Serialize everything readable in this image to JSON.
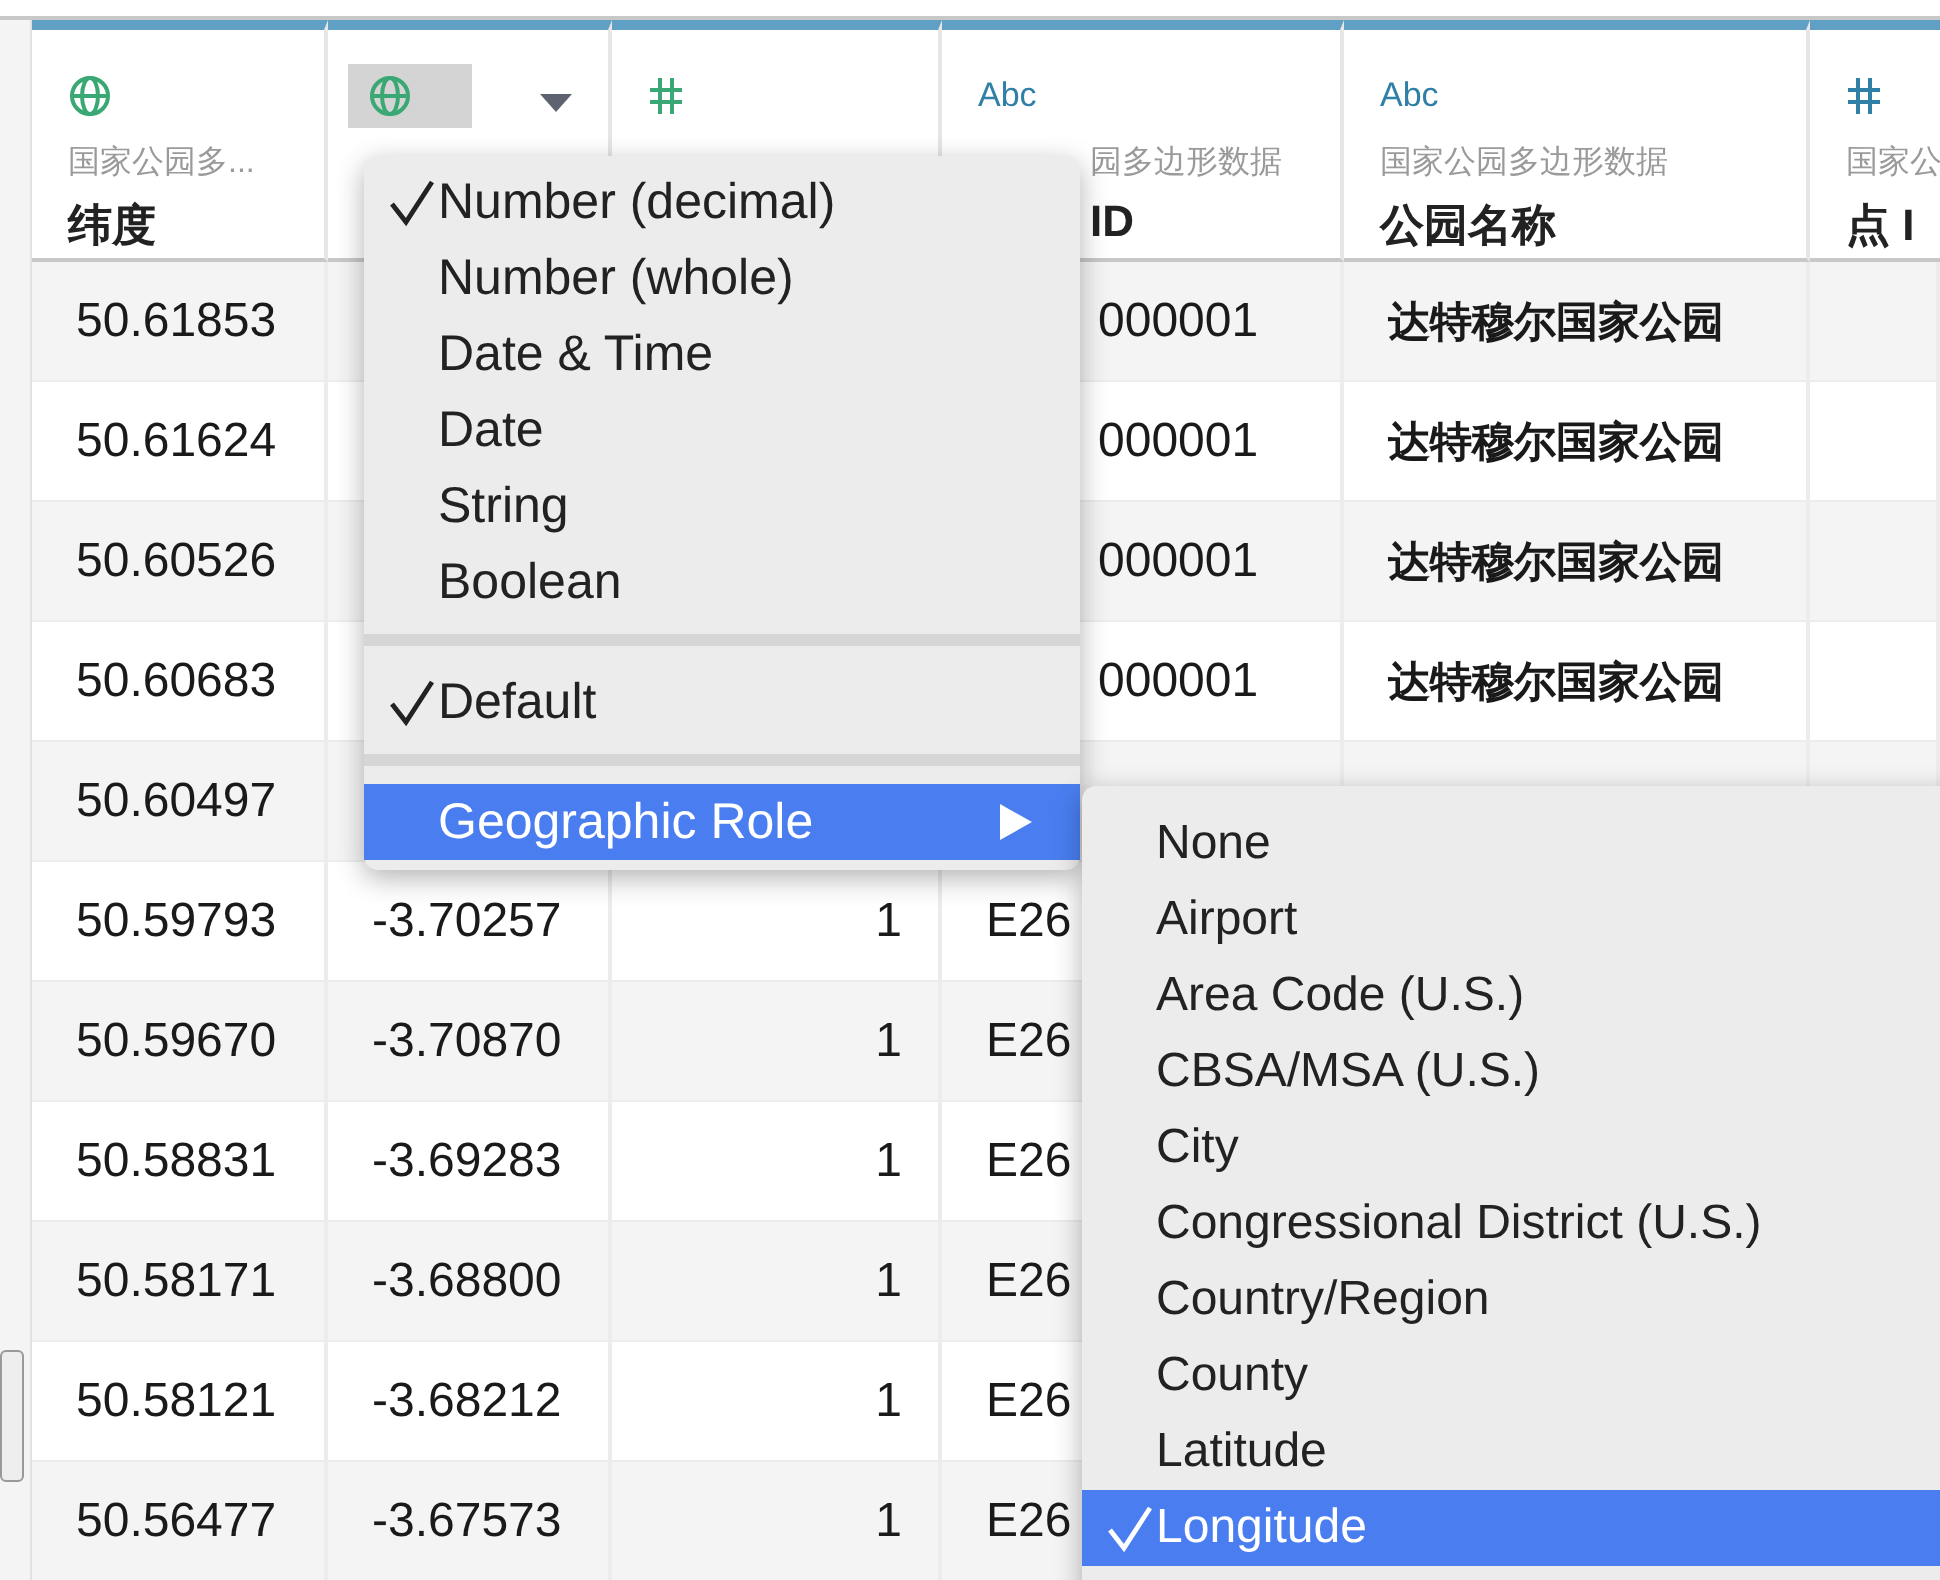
{
  "columns": [
    {
      "kind": "geo",
      "selected": false,
      "dropdown": false,
      "partial": false,
      "source": "国家公园多...",
      "name": "纬度"
    },
    {
      "kind": "geo",
      "selected": true,
      "dropdown": true,
      "partial": false
    },
    {
      "kind": "number",
      "selected": false,
      "dropdown": false,
      "partial": false
    },
    {
      "kind": "string",
      "type_label": "Abc",
      "selected": false,
      "dropdown": false,
      "partial": true,
      "source": "园多边形数据",
      "name": "ID"
    },
    {
      "kind": "string",
      "type_label": "Abc",
      "selected": false,
      "dropdown": false,
      "partial": false,
      "source": "国家公园多边形数据",
      "name": "公园名称"
    },
    {
      "kind": "number",
      "selected": false,
      "dropdown": false,
      "partial": false,
      "source": "国家公",
      "name": "点 I"
    }
  ],
  "rows": [
    {
      "cells": [
        "50.61853",
        null,
        null,
        "000001",
        "达特穆尔国家公园",
        null
      ],
      "id_partial": true
    },
    {
      "cells": [
        "50.61624",
        null,
        null,
        "000001",
        "达特穆尔国家公园",
        null
      ],
      "id_partial": true
    },
    {
      "cells": [
        "50.60526",
        null,
        null,
        "000001",
        "达特穆尔国家公园",
        null
      ],
      "id_partial": true
    },
    {
      "cells": [
        "50.60683",
        null,
        null,
        "000001",
        "达特穆尔国家公园",
        null
      ],
      "id_partial": true
    },
    {
      "cells": [
        "50.60497",
        null,
        null,
        null,
        null,
        null
      ]
    },
    {
      "cells": [
        "50.59793",
        "-3.70257",
        "1",
        "E26",
        null,
        null
      ],
      "id_partial": false
    },
    {
      "cells": [
        "50.59670",
        "-3.70870",
        "1",
        "E26",
        null,
        null
      ],
      "id_partial": false
    },
    {
      "cells": [
        "50.58831",
        "-3.69283",
        "1",
        "E26",
        null,
        null
      ],
      "id_partial": false
    },
    {
      "cells": [
        "50.58171",
        "-3.68800",
        "1",
        "E26",
        null,
        null
      ],
      "id_partial": false
    },
    {
      "cells": [
        "50.58121",
        "-3.68212",
        "1",
        "E26",
        null,
        null
      ],
      "id_partial": false
    },
    {
      "cells": [
        "50.56477",
        "-3.67573",
        "1",
        "E26",
        null,
        null
      ],
      "id_partial": false
    }
  ],
  "menu": {
    "items": [
      {
        "kind": "item",
        "label": "Number (decimal)",
        "checked": true,
        "highlighted": false,
        "submenu": false
      },
      {
        "kind": "item",
        "label": "Number (whole)",
        "checked": false,
        "highlighted": false,
        "submenu": false
      },
      {
        "kind": "item",
        "label": "Date & Time",
        "checked": false,
        "highlighted": false,
        "submenu": false
      },
      {
        "kind": "item",
        "label": "Date",
        "checked": false,
        "highlighted": false,
        "submenu": false
      },
      {
        "kind": "item",
        "label": "String",
        "checked": false,
        "highlighted": false,
        "submenu": false
      },
      {
        "kind": "item",
        "label": "Boolean",
        "checked": false,
        "highlighted": false,
        "submenu": false
      },
      {
        "kind": "separator"
      },
      {
        "kind": "item",
        "label": "Default",
        "checked": true,
        "highlighted": false,
        "submenu": false
      },
      {
        "kind": "separator"
      },
      {
        "kind": "item",
        "label": "Geographic Role",
        "checked": false,
        "highlighted": true,
        "submenu": true
      }
    ]
  },
  "submenu": {
    "items": [
      {
        "label": "None",
        "checked": false,
        "highlighted": false
      },
      {
        "label": "Airport",
        "checked": false,
        "highlighted": false
      },
      {
        "label": "Area Code (U.S.)",
        "checked": false,
        "highlighted": false
      },
      {
        "label": "CBSA/MSA (U.S.)",
        "checked": false,
        "highlighted": false
      },
      {
        "label": "City",
        "checked": false,
        "highlighted": false
      },
      {
        "label": "Congressional District (U.S.)",
        "checked": false,
        "highlighted": false
      },
      {
        "label": "Country/Region",
        "checked": false,
        "highlighted": false
      },
      {
        "label": "County",
        "checked": false,
        "highlighted": false
      },
      {
        "label": "Latitude",
        "checked": false,
        "highlighted": false
      },
      {
        "label": "Longitude",
        "checked": true,
        "highlighted": true
      }
    ]
  }
}
